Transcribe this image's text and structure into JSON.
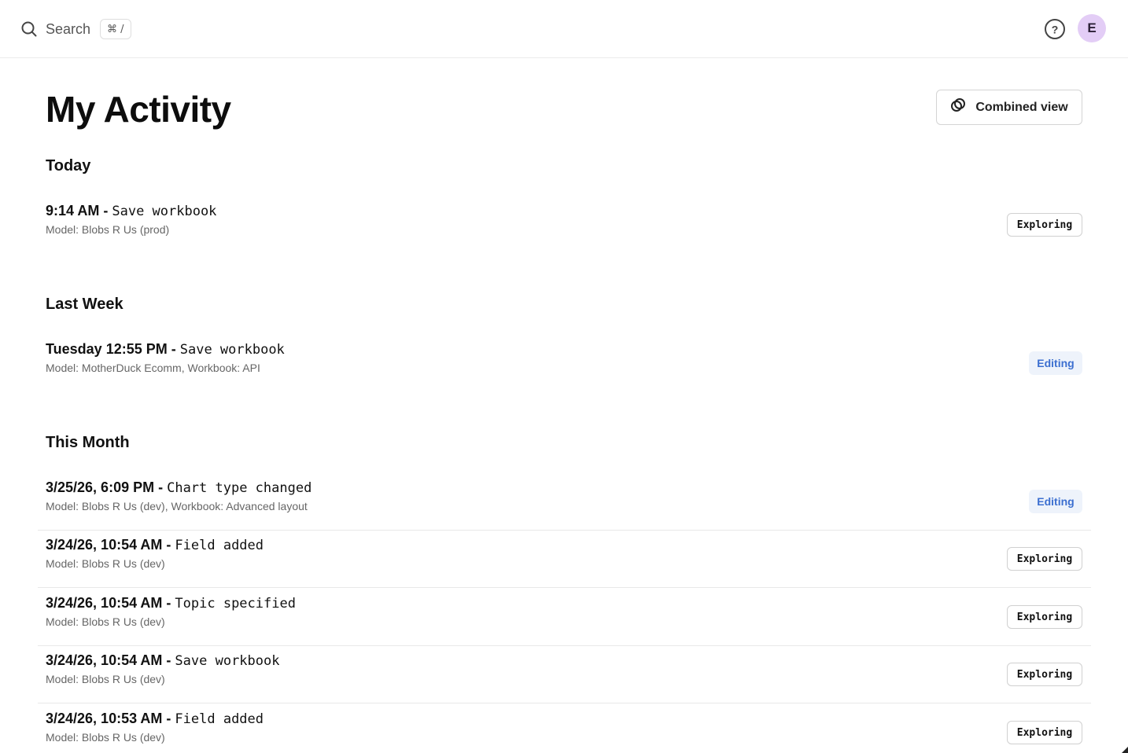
{
  "search": {
    "placeholder": "Search",
    "shortcut": "⌘ /"
  },
  "user": {
    "initial": "E"
  },
  "page": {
    "title": "My Activity",
    "combined_view_label": "Combined view"
  },
  "sections": [
    {
      "title": "Today",
      "items": [
        {
          "time": "9:14 AM",
          "action": "Save workbook",
          "detail": "Model: Blobs R Us (prod)",
          "mode": "Exploring"
        }
      ]
    },
    {
      "title": "Last Week",
      "items": [
        {
          "time": "Tuesday 12:55 PM",
          "action": "Save workbook",
          "detail": "Model: MotherDuck Ecomm, Workbook: API",
          "mode": "Editing"
        }
      ]
    },
    {
      "title": "This Month",
      "items": [
        {
          "time": "3/25/26, 6:09 PM",
          "action": "Chart type changed",
          "detail": "Model: Blobs R Us (dev), Workbook: Advanced layout",
          "mode": "Editing"
        },
        {
          "time": "3/24/26, 10:54 AM",
          "action": "Field added",
          "detail": "Model: Blobs R Us (dev)",
          "mode": "Exploring"
        },
        {
          "time": "3/24/26, 10:54 AM",
          "action": "Topic specified",
          "detail": "Model: Blobs R Us (dev)",
          "mode": "Exploring"
        },
        {
          "time": "3/24/26, 10:54 AM",
          "action": "Save workbook",
          "detail": "Model: Blobs R Us (dev)",
          "mode": "Exploring"
        },
        {
          "time": "3/24/26, 10:53 AM",
          "action": "Field added",
          "detail": "Model: Blobs R Us (dev)",
          "mode": "Exploring"
        }
      ]
    }
  ],
  "separator": " - "
}
